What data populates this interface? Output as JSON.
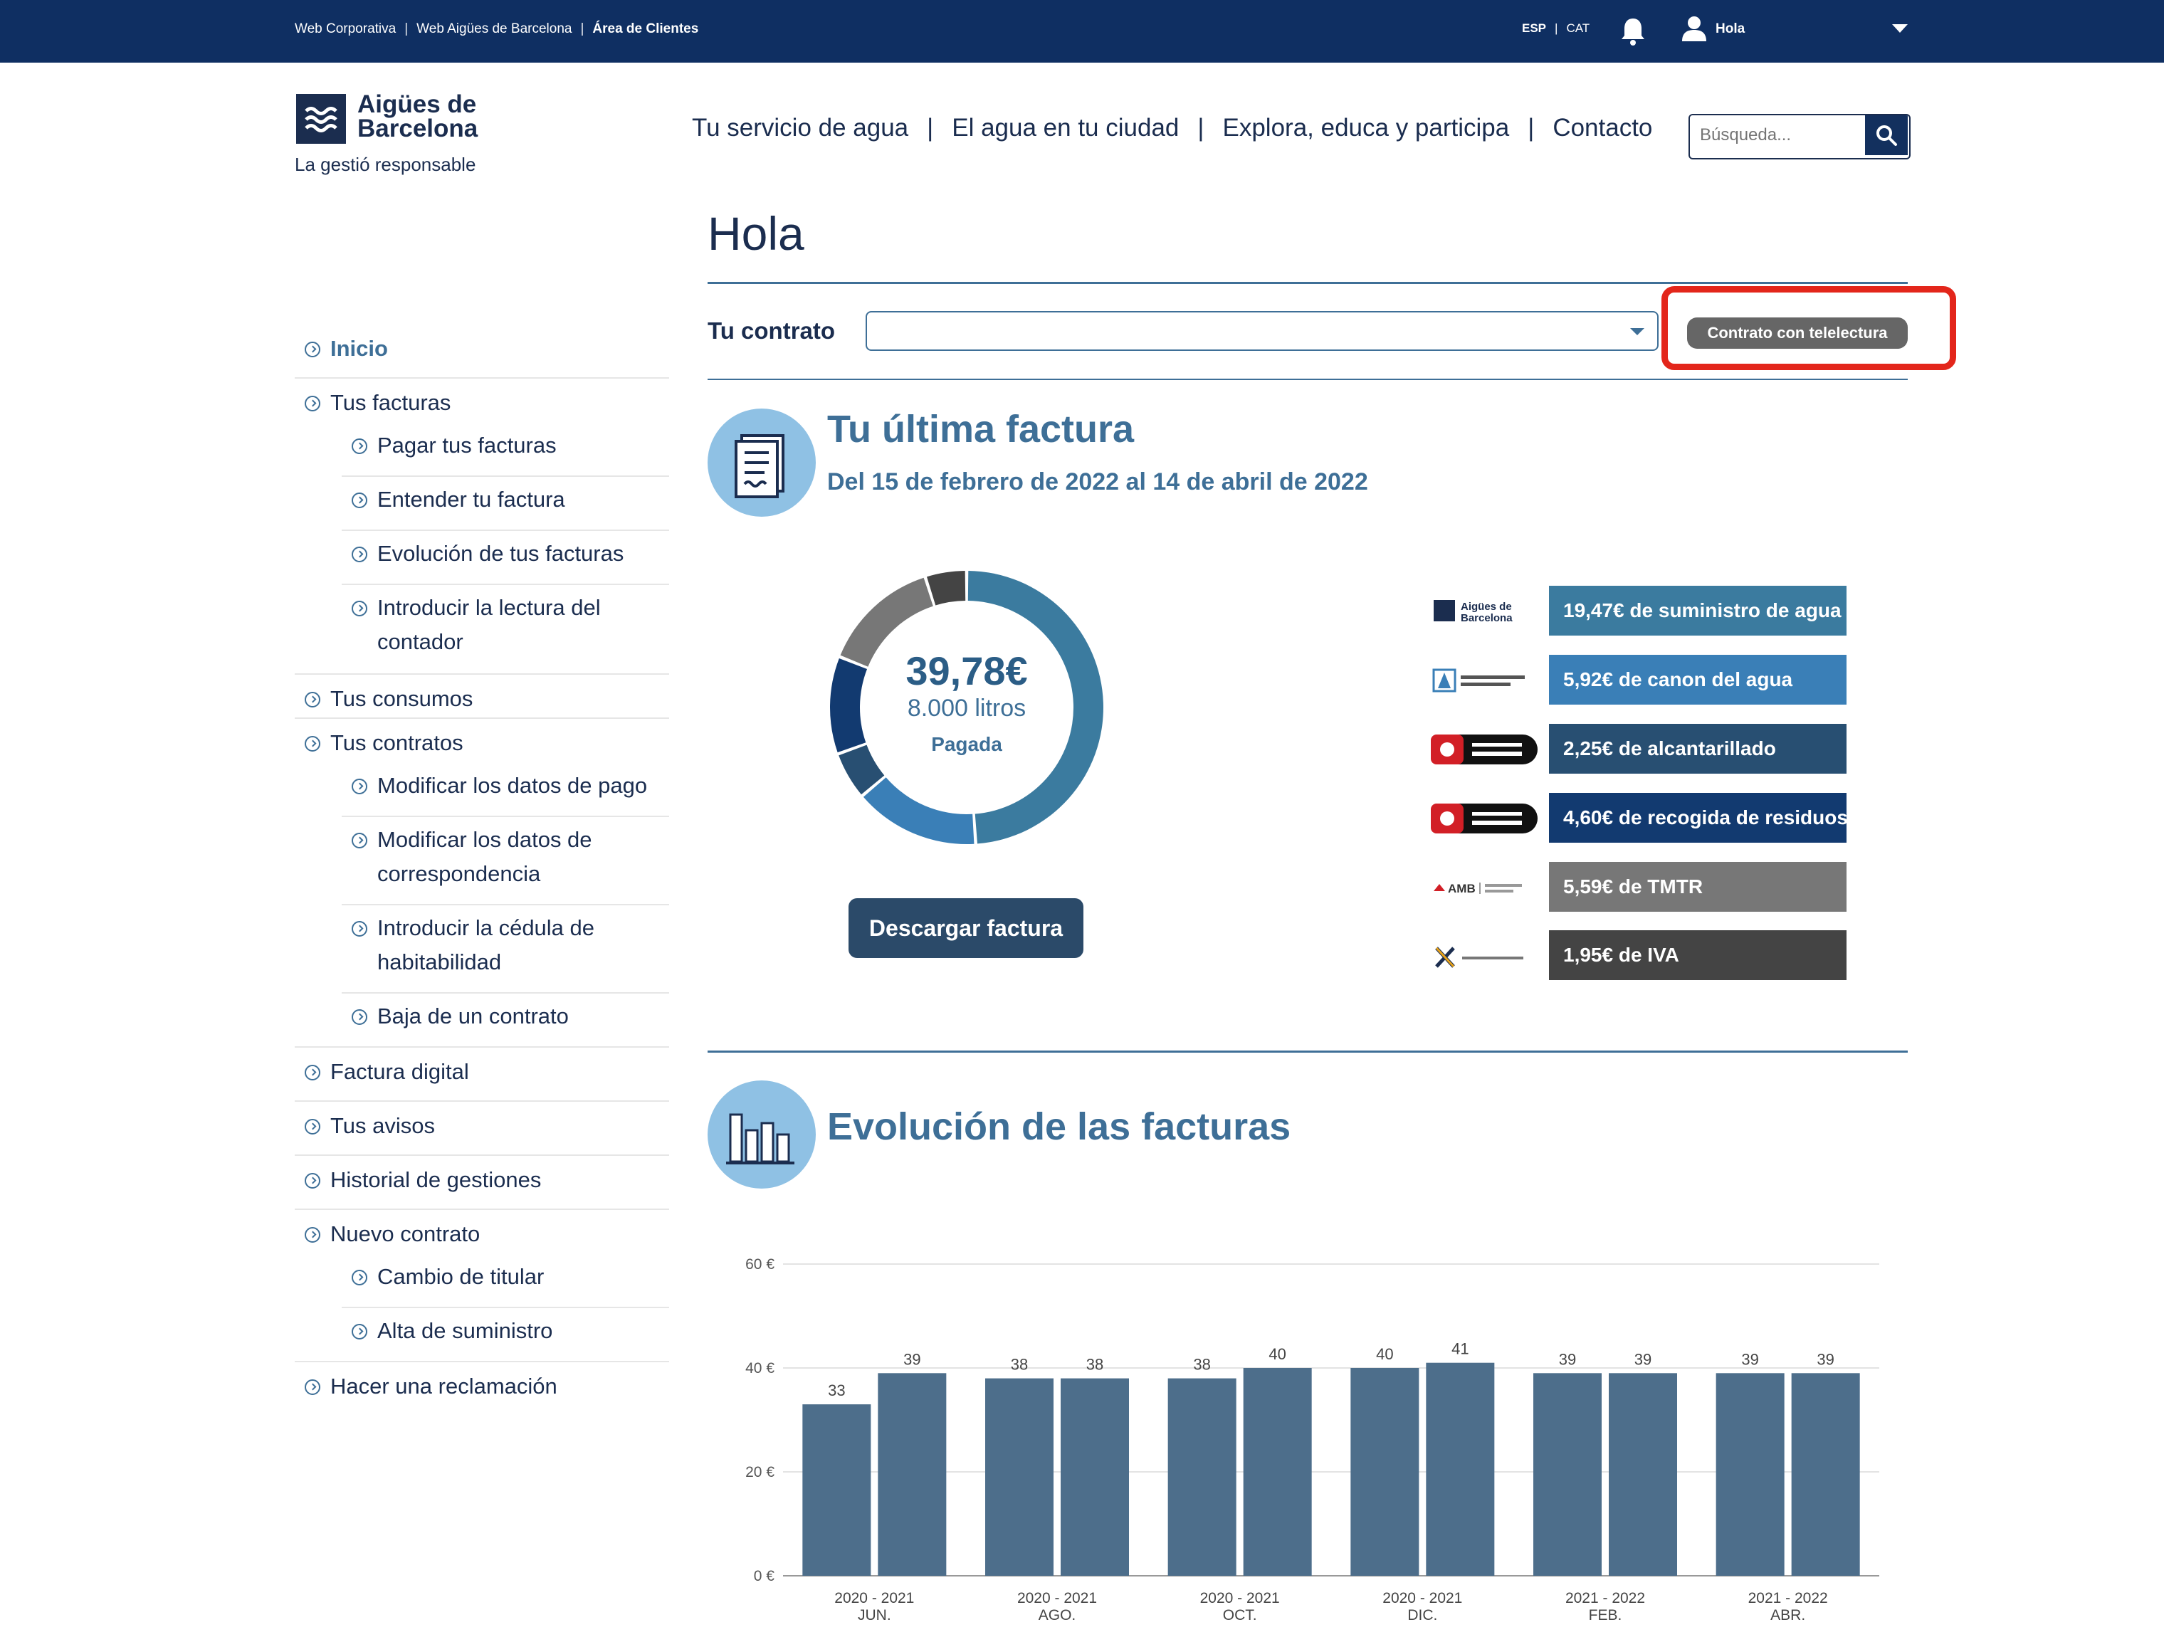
{
  "topbar": {
    "links": [
      "Web Corporativa",
      "Web Aigües de Barcelona",
      "Área de Clientes"
    ],
    "separator": "|",
    "lang_es": "ESP",
    "lang_ca": "CAT",
    "greeting": "Hola",
    "icons": [
      "bell-icon",
      "user-icon",
      "caret-down-icon"
    ]
  },
  "logo": {
    "line1": "Aigües de",
    "line2": "Barcelona",
    "tagline": "La gestió responsable"
  },
  "mainnav": {
    "items": [
      "Tu servicio de agua",
      "El agua en tu ciudad",
      "Explora, educa y participa",
      "Contacto"
    ],
    "separator": "|",
    "search_placeholder": "Búsqueda..."
  },
  "page": {
    "title": "Hola",
    "contract_label": "Tu contrato",
    "contract_value": "",
    "tele_button": "Contrato con telelectura"
  },
  "sidebar": {
    "items": [
      {
        "label": "Inicio",
        "level": 1,
        "active": true
      },
      {
        "label": "Tus facturas",
        "level": 1
      },
      {
        "label": "Pagar tus facturas",
        "level": 2
      },
      {
        "label": "Entender tu factura",
        "level": 2
      },
      {
        "label": "Evolución de tus facturas",
        "level": 2
      },
      {
        "label": "Introducir la lectura del contador",
        "level": 2
      },
      {
        "label": "Tus consumos",
        "level": 1
      },
      {
        "label": "Tus contratos",
        "level": 1
      },
      {
        "label": "Modificar los datos de pago",
        "level": 2
      },
      {
        "label": "Modificar los datos de correspondencia",
        "level": 2
      },
      {
        "label": "Introducir la cédula de habitabilidad",
        "level": 2
      },
      {
        "label": "Baja de un contrato",
        "level": 2
      },
      {
        "label": "Factura digital",
        "level": 1
      },
      {
        "label": "Tus avisos",
        "level": 1
      },
      {
        "label": "Historial de gestiones",
        "level": 1
      },
      {
        "label": "Nuevo contrato",
        "level": 1
      },
      {
        "label": "Cambio de titular",
        "level": 2
      },
      {
        "label": "Alta de suministro",
        "level": 2
      },
      {
        "label": "Hacer una reclamación",
        "level": 1
      }
    ]
  },
  "last_invoice": {
    "title": "Tu última factura",
    "period": "Del 15 de febrero de 2022 al 14 de abril de 2022",
    "amount": "39,78€",
    "liters": "8.000 litros",
    "status": "Pagada",
    "download_button": "Descargar factura",
    "breakdown": [
      {
        "label": "19,47€ de suministro de agua",
        "value": 19.47,
        "color": "#3b7b9f",
        "logo": "Aigües de Barcelona"
      },
      {
        "label": "5,92€ de canon del agua",
        "value": 5.92,
        "color": "#3a7fb7",
        "logo": "Agència Catalana de l'Aigua"
      },
      {
        "label": "2,25€ de alcantarillado",
        "value": 2.25,
        "color": "#284f72",
        "logo": "Ajuntament de Barcelona"
      },
      {
        "label": "4,60€ de recogida de residuos",
        "value": 4.6,
        "color": "#123a70",
        "logo": "Ajuntament de Barcelona"
      },
      {
        "label": "5,59€ de TMTR",
        "value": 5.59,
        "color": "#777777",
        "logo": "AMB"
      },
      {
        "label": "1,95€ de IVA",
        "value": 1.95,
        "color": "#444444",
        "logo": "Agencia Tributaria"
      }
    ]
  },
  "evolution": {
    "title": "Evolución de las facturas"
  },
  "chart_data": {
    "type": "bar",
    "categories": [
      [
        "2020 - 2021",
        "JUN."
      ],
      [
        "2020 - 2021",
        "AGO."
      ],
      [
        "2020 - 2021",
        "OCT."
      ],
      [
        "2020 - 2021",
        "DIC."
      ],
      [
        "2021 - 2022",
        "FEB."
      ],
      [
        "2021 - 2022",
        "ABR."
      ]
    ],
    "series": [
      {
        "values": [
          33,
          38,
          38,
          40,
          39,
          39
        ]
      },
      {
        "values": [
          39,
          38,
          40,
          41,
          39,
          39
        ]
      }
    ],
    "y_ticks": [
      "0 €",
      "20 €",
      "40 €",
      "60 €"
    ],
    "ylim": [
      0,
      60
    ],
    "grid": true,
    "bar_color": "#4d6e8b"
  }
}
